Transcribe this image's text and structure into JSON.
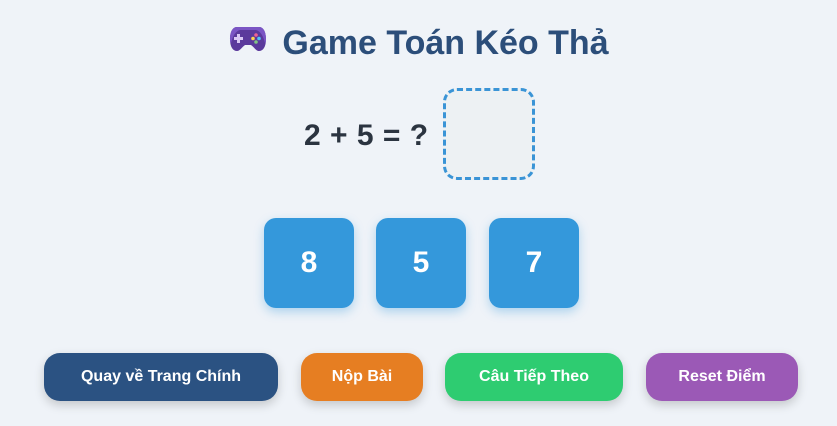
{
  "header": {
    "icon": "gamepad-icon",
    "title": "Game Toán Kéo Thả"
  },
  "question": {
    "equation": "2 + 5 = ?",
    "answer_slot": ""
  },
  "options": [
    {
      "value": "8"
    },
    {
      "value": "5"
    },
    {
      "value": "7"
    }
  ],
  "buttons": {
    "home": {
      "label": "Quay về Trang Chính",
      "color": "#2b5282"
    },
    "submit": {
      "label": "Nộp Bài",
      "color": "#e67e22"
    },
    "next": {
      "label": "Câu Tiếp Theo",
      "color": "#2ecc71"
    },
    "reset": {
      "label": "Reset Điểm",
      "color": "#9b59b6"
    }
  },
  "colors": {
    "background": "#eff3f8",
    "title": "#2c4e7a",
    "tile": "#3498db",
    "dropzone_border": "#3a94d6"
  }
}
